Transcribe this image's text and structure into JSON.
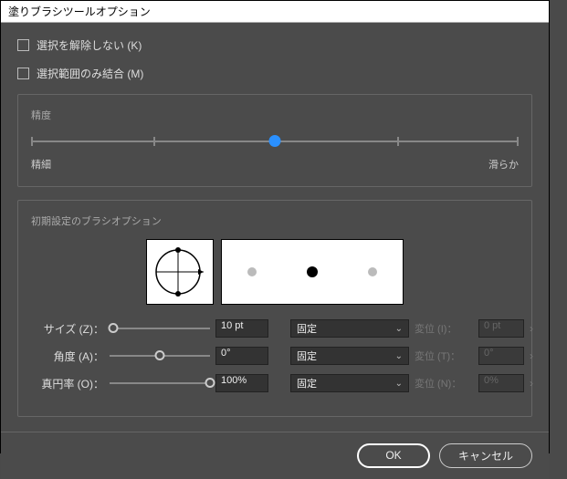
{
  "dialog": {
    "title": "塗りブラシツールオプション"
  },
  "checkboxes": {
    "keep_selected": "選択を解除しない (K)",
    "merge_selection": "選択範囲のみ結合 (M)"
  },
  "accuracy": {
    "label": "精度",
    "left": "精細",
    "right": "滑らか"
  },
  "brush_defaults": {
    "label": "初期設定のブラシオプション"
  },
  "params": {
    "size": {
      "label": "サイズ (Z)：",
      "value": "10 pt",
      "type_label": "固定",
      "variation_label": "変位 (I)：",
      "variation_value": "0 pt"
    },
    "angle": {
      "label": "角度 (A)：",
      "value": "0°",
      "type_label": "固定",
      "variation_label": "変位 (T)：",
      "variation_value": "0°"
    },
    "roundness": {
      "label": "真円率 (O)：",
      "value": "100%",
      "type_label": "固定",
      "variation_label": "変位 (N)：",
      "variation_value": "0%"
    }
  },
  "buttons": {
    "ok": "OK",
    "cancel": "キャンセル"
  }
}
